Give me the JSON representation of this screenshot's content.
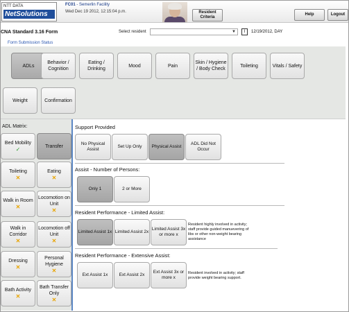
{
  "header": {
    "logo_top": "NTT DATA",
    "logo_main": "NetSolutions",
    "facility_code": "FC01",
    "facility_sep": " - ",
    "facility_name": "Semerlin Facility",
    "datetime": "Wed Dec 19 2012, 12:15:04 p.m.",
    "resident_criteria": "Resident Criteria",
    "help": "Help",
    "logout": "Logout"
  },
  "form": {
    "title": "CNA Standard 3.16 Form",
    "select_label": "Select resident",
    "select_value": "",
    "date_value": "12/19/2012, DAY",
    "calendar_icon": "I",
    "status_link": "Form Submission Status"
  },
  "categories": [
    {
      "label": "ADLs"
    },
    {
      "label": "Behavior / Cognition"
    },
    {
      "label": "Eating / Drinking"
    },
    {
      "label": "Mood"
    },
    {
      "label": "Pain"
    },
    {
      "label": "Skin / Hygiene / Body Check"
    },
    {
      "label": "Toileting"
    },
    {
      "label": "Vitals / Safety"
    },
    {
      "label": "Weight"
    },
    {
      "label": "Confirmation"
    }
  ],
  "adl_matrix": {
    "title": "ADL Matrix:",
    "items": [
      {
        "label": "Bed Mobility",
        "mark": "✓"
      },
      {
        "label": "Transfer",
        "mark": ""
      },
      {
        "label": "Toileting",
        "mark": "✕"
      },
      {
        "label": "Eating",
        "mark": "✕"
      },
      {
        "label": "Walk in Room",
        "mark": "✕"
      },
      {
        "label": "Locomotion on Unit",
        "mark": "✕"
      },
      {
        "label": "Walk in Corridor",
        "mark": "✕"
      },
      {
        "label": "Locomotion off Unit",
        "mark": "✕"
      },
      {
        "label": "Dressing",
        "mark": "✕"
      },
      {
        "label": "Personal Hygiene",
        "mark": "✕"
      },
      {
        "label": "Bath Activity",
        "mark": "✕"
      },
      {
        "label": "Bath Transfer Only",
        "mark": "✕"
      }
    ]
  },
  "support": {
    "title": "Support Provided",
    "options": [
      "No Physical Assist",
      "Set Up Only",
      "Physical Assist",
      "ADL Did Not Occur"
    ]
  },
  "persons": {
    "title": "Assist - Number of Persons:",
    "options": [
      "Only 1",
      "2 or More"
    ]
  },
  "limited": {
    "title": "Resident Performance - Limited Assist:",
    "options": [
      "Limited Assist 1x",
      "Limited Assist 2x",
      "Limited Assist 3x or more x"
    ],
    "description": "Resident highly involved in activity; staff provide guided manuevering of libs or other non-weight bearing assistance"
  },
  "extensive": {
    "title": "Resident Performance - Extensive Assist:",
    "options": [
      "Ext Assist 1x",
      "Ext Assist 2x",
      "Ext Assist 3x or more x"
    ],
    "description": "Resident involved in activity; staff provide weight bearing support."
  }
}
